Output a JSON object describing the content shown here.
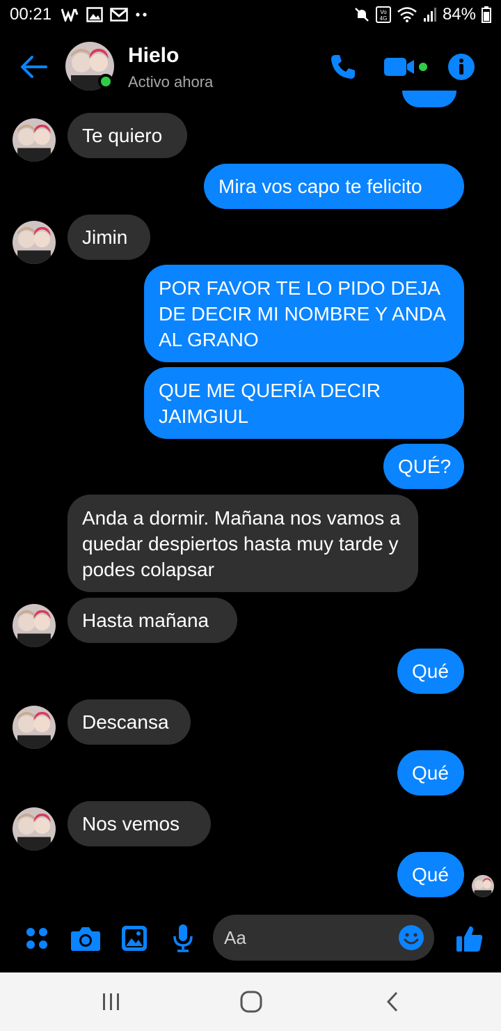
{
  "status_bar": {
    "time": "00:21",
    "battery": "84%",
    "icons": [
      "w-app-icon",
      "gallery-icon",
      "gmail-icon",
      "more-dots-icon",
      "mute-icon",
      "volte-4g-icon",
      "wifi-icon",
      "signal-icon",
      "battery-icon"
    ]
  },
  "header": {
    "name": "Hielo",
    "status": "Activo ahora",
    "accent": "#0a84ff",
    "online_color": "#31cc46"
  },
  "messages": [
    {
      "side": "in",
      "text": "Te quiero"
    },
    {
      "side": "out",
      "text": "Mira vos capo te felicito"
    },
    {
      "side": "in",
      "text": "Jimin"
    },
    {
      "side": "out",
      "text": "POR FAVOR TE LO PIDO DEJA DE DECIR MI NOMBRE Y ANDA AL GRANO"
    },
    {
      "side": "out",
      "text": "QUE ME QUERÍA DECIR JAIMGIUL"
    },
    {
      "side": "out",
      "text": "QUÉ?"
    },
    {
      "side": "in",
      "text": "Anda a dormir. Mañana nos vamos a quedar despiertos hasta muy tarde y podes colapsar"
    },
    {
      "side": "in",
      "text": "Hasta mañana"
    },
    {
      "side": "out",
      "text": "Qué"
    },
    {
      "side": "in",
      "text": "Descansa"
    },
    {
      "side": "out",
      "text": "Qué"
    },
    {
      "side": "in",
      "text": "Nos vemos"
    },
    {
      "side": "out",
      "text": "Qué"
    }
  ],
  "composer": {
    "placeholder": "Aa",
    "icons": [
      "apps-icon",
      "camera-icon",
      "image-icon",
      "microphone-icon",
      "emoji-icon",
      "thumbs-up-icon"
    ]
  },
  "colors": {
    "incoming_bubble": "#303030",
    "outgoing_bubble": "#0a84ff",
    "background": "#000000"
  }
}
